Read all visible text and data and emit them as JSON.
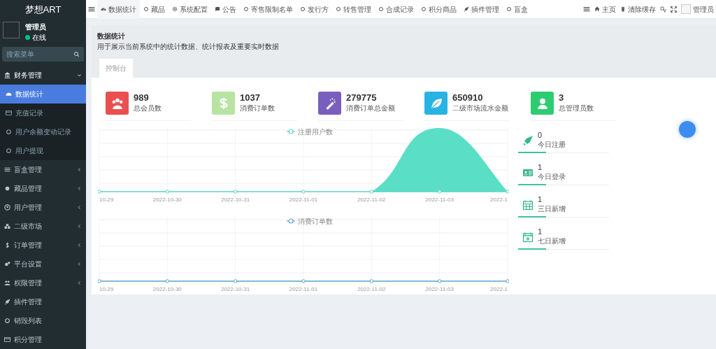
{
  "brand": "梦想ART",
  "user": {
    "name": "管理员",
    "status": "在线",
    "online": true
  },
  "search": {
    "placeholder": "搜索菜单"
  },
  "sidebar": {
    "items": [
      {
        "label": "财务管理",
        "expanded": true,
        "children": [
          {
            "label": "数据统计",
            "selected": true
          },
          {
            "label": "充值记录",
            "selected": false
          },
          {
            "label": "用户余额变动记录",
            "selected": false
          },
          {
            "label": "用户提现",
            "selected": false
          }
        ]
      },
      {
        "label": "盲盒管理",
        "expanded": false
      },
      {
        "label": "藏品管理",
        "expanded": false
      },
      {
        "label": "用户管理",
        "expanded": false
      },
      {
        "label": "二级市场",
        "expanded": false
      },
      {
        "label": "订单管理",
        "expanded": false
      },
      {
        "label": "平台设置",
        "expanded": false
      },
      {
        "label": "权限管理",
        "expanded": false
      },
      {
        "label": "插件管理"
      },
      {
        "label": "销毁列表"
      },
      {
        "label": "积分管理"
      }
    ]
  },
  "tabs": [
    {
      "label": "数据统计",
      "selected": true
    },
    {
      "label": "藏品",
      "selected": false
    },
    {
      "label": "系统配置",
      "selected": false
    },
    {
      "label": "公告",
      "selected": false
    },
    {
      "label": "寄售限制名单",
      "selected": false
    },
    {
      "label": "发行方",
      "selected": false
    },
    {
      "label": "转售管理",
      "selected": false
    },
    {
      "label": "合成记录",
      "selected": false
    },
    {
      "label": "积分商品",
      "selected": false
    },
    {
      "label": "插件管理",
      "selected": false
    },
    {
      "label": "盲盒",
      "selected": false
    }
  ],
  "toolbar": {
    "home": "主页",
    "clear_cache": "清除缓存",
    "account": "管理员"
  },
  "page": {
    "title": "数据统计",
    "description": "用于展示当前系统中的统计数据、统计报表及重要实时数据",
    "tab": "控制台"
  },
  "stats": [
    {
      "value": "989",
      "label": "总会员数",
      "color": "#e9504f"
    },
    {
      "value": "1037",
      "label": "消费订单数",
      "color": "#b8e4a3"
    },
    {
      "value": "279775",
      "label": "消费订单总金额",
      "color": "#7a5ebd"
    },
    {
      "value": "650910",
      "label": "二级市场流水金额",
      "color": "#29b3e3"
    },
    {
      "value": "3",
      "label": "总管理员数",
      "color": "#2ecc71"
    }
  ],
  "charts": [
    {
      "legend": "注册用户数",
      "x_labels": [
        "10-29",
        "2022-10-30",
        "2022-10-31",
        "2022-11-01",
        "2022-11-02",
        "2022-11-03",
        "2022-1"
      ]
    },
    {
      "legend": "消费订单数",
      "x_labels": [
        "10-29",
        "2022-10-30",
        "2022-10-31",
        "2022-11-01",
        "2022-11-02",
        "2022-11-03",
        "2022-1"
      ]
    }
  ],
  "quick_stats": [
    {
      "value": "0",
      "label": "今日注册"
    },
    {
      "value": "1",
      "label": "今日登录"
    },
    {
      "value": "1",
      "label": "三日新增"
    },
    {
      "value": "1",
      "label": "七日新增"
    }
  ]
}
